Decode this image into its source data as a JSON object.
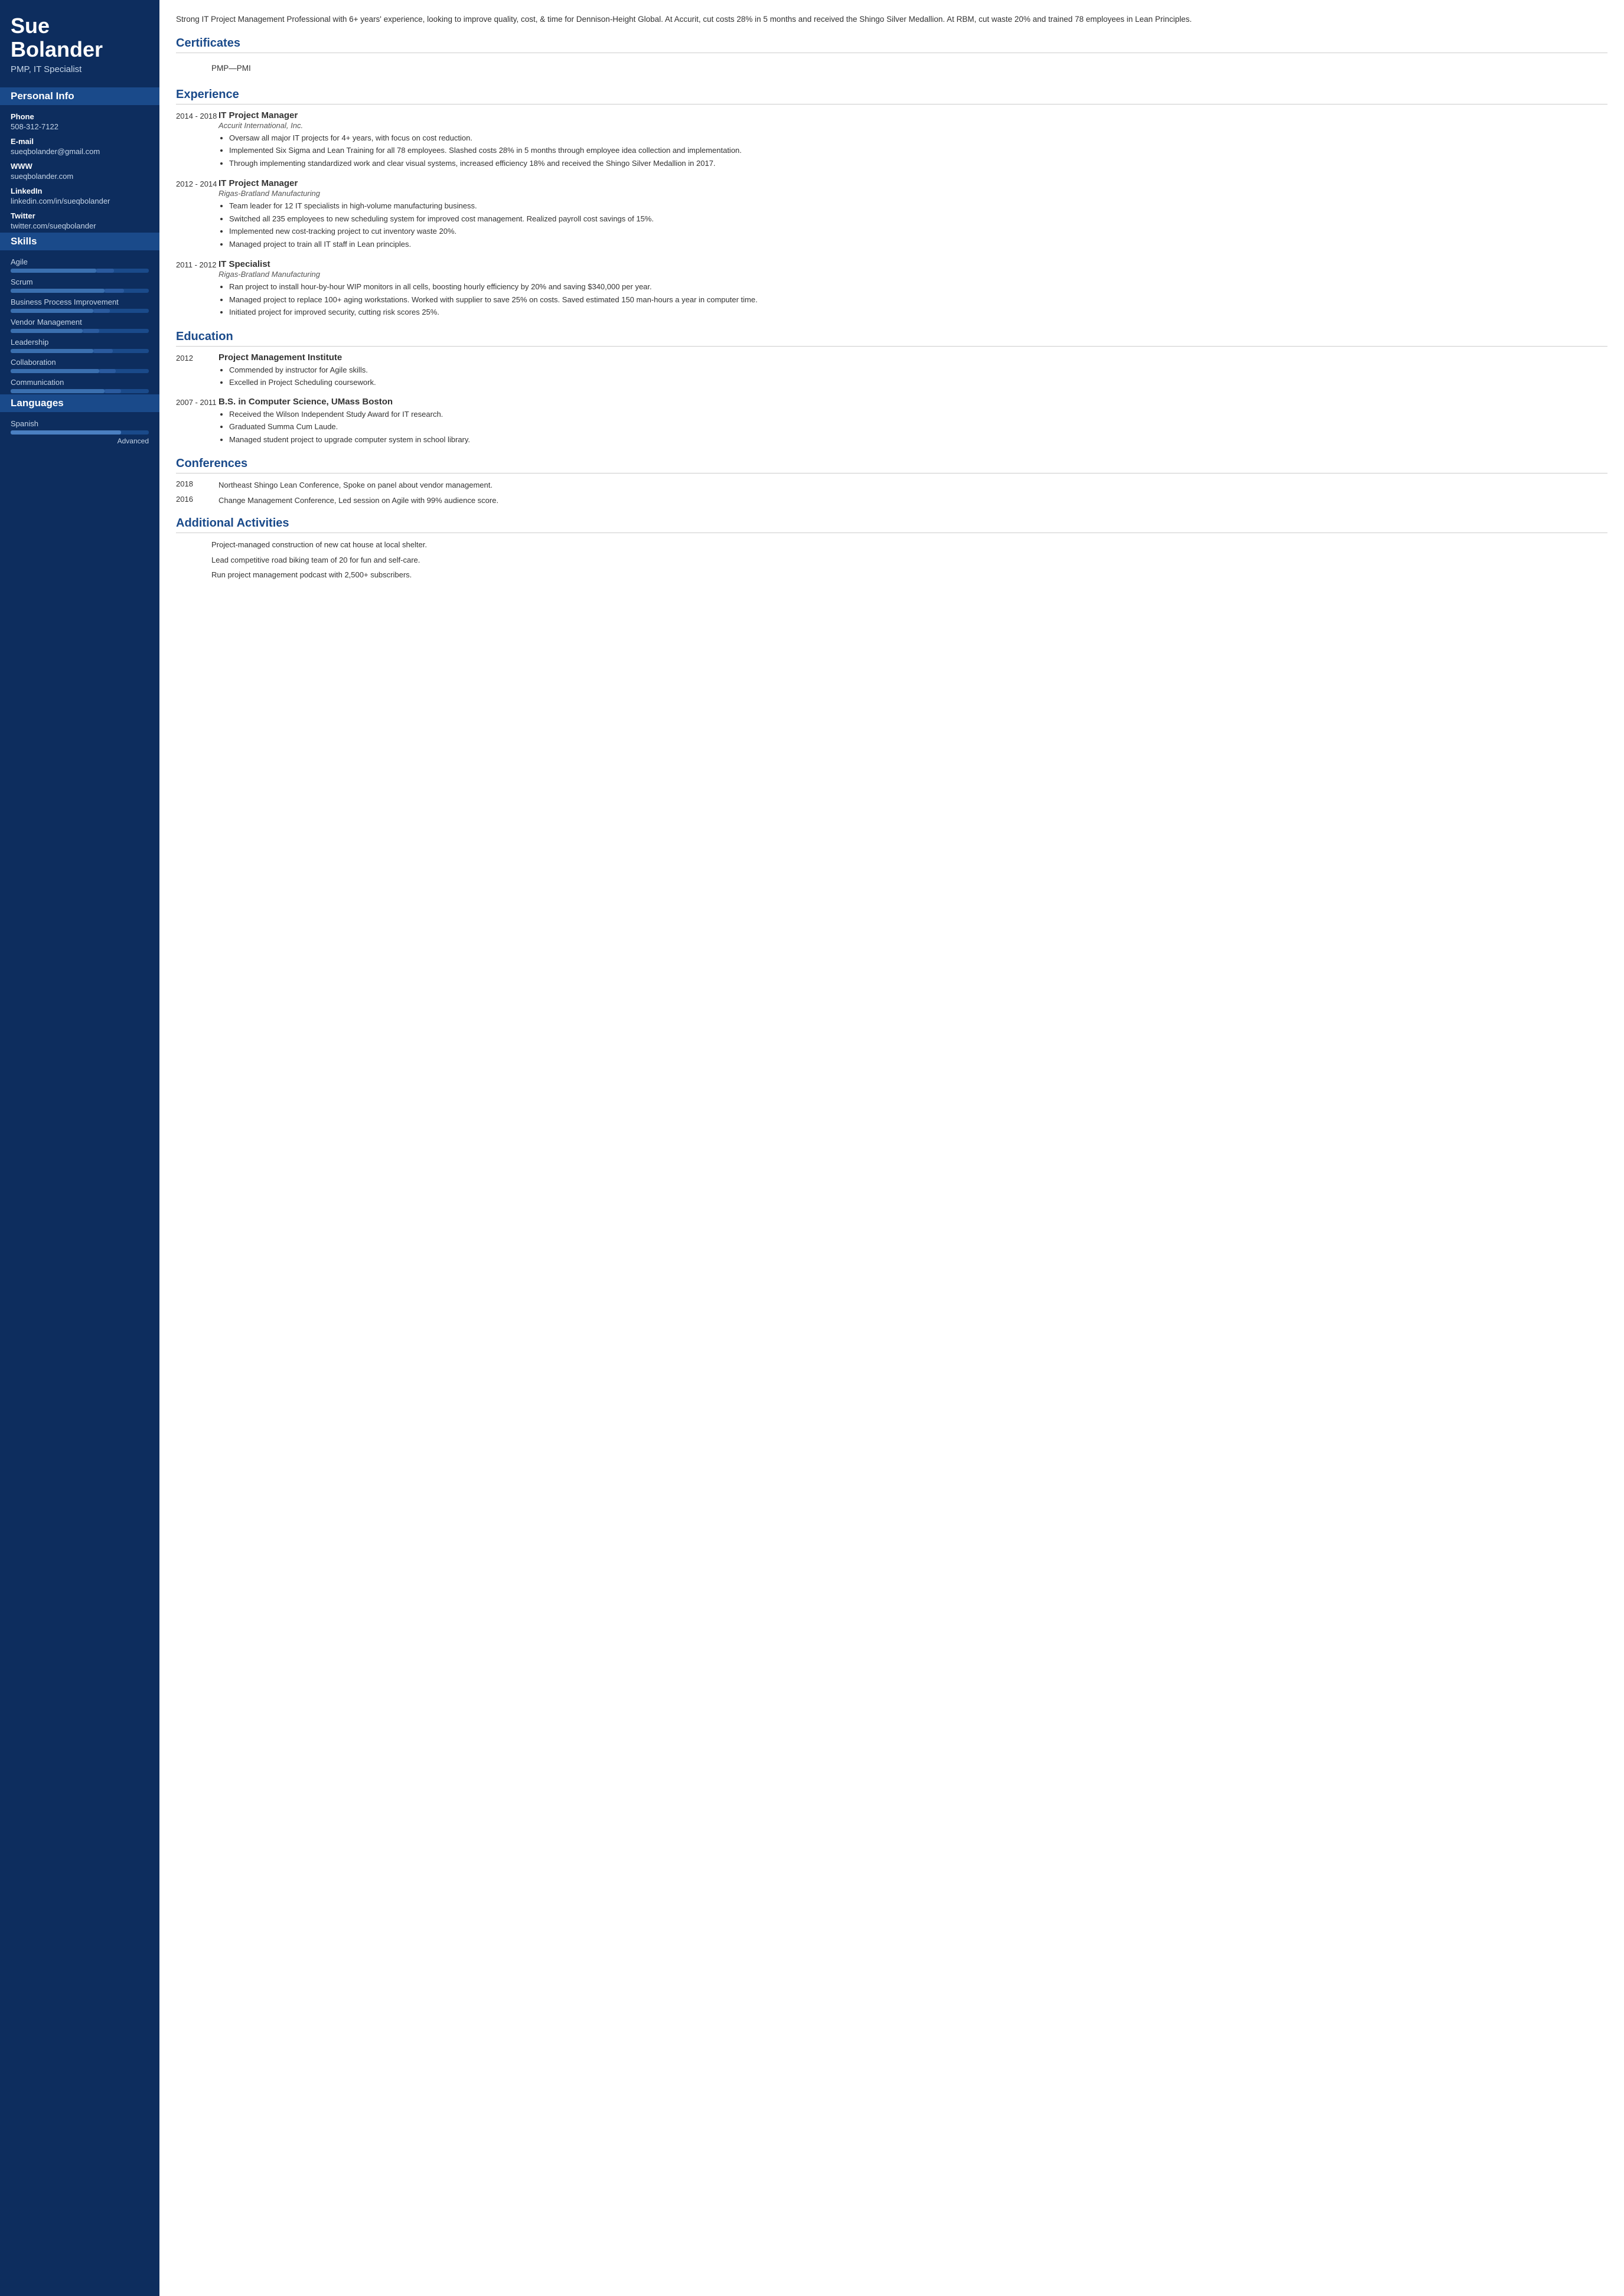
{
  "sidebar": {
    "name_line1": "Sue",
    "name_line2": "Bolander",
    "title": "PMP, IT Specialist",
    "personal_info_label": "Personal Info",
    "phone_label": "Phone",
    "phone_value": "508-312-7122",
    "email_label": "E-mail",
    "email_value": "sueqbolander@gmail.com",
    "www_label": "WWW",
    "www_value": "sueqbolander.com",
    "linkedin_label": "LinkedIn",
    "linkedin_value": "linkedin.com/in/sueqbolander",
    "twitter_label": "Twitter",
    "twitter_value": "twitter.com/sueqbolander",
    "skills_label": "Skills",
    "skills": [
      {
        "name": "Agile",
        "fill": 62,
        "accent": 75
      },
      {
        "name": "Scrum",
        "fill": 68,
        "accent": 82
      },
      {
        "name": "Business Process Improvement",
        "fill": 60,
        "accent": 72
      },
      {
        "name": "Vendor Management",
        "fill": 52,
        "accent": 64
      },
      {
        "name": "Leadership",
        "fill": 60,
        "accent": 74
      },
      {
        "name": "Collaboration",
        "fill": 64,
        "accent": 76
      },
      {
        "name": "Communication",
        "fill": 68,
        "accent": 80
      }
    ],
    "languages_label": "Languages",
    "languages": [
      {
        "name": "Spanish",
        "fill": 80,
        "level": "Advanced"
      }
    ]
  },
  "main": {
    "summary": "Strong IT Project Management Professional with 6+ years' experience, looking to improve quality, cost, & time for Dennison-Height Global. At Accurit, cut costs 28% in 5 months and received the Shingo Silver Medallion. At RBM, cut waste 20% and trained 78 employees in Lean Principles.",
    "certificates_label": "Certificates",
    "certificate_value": "PMP—PMI",
    "experience_label": "Experience",
    "experience": [
      {
        "date": "2014 - 2018",
        "title": "IT Project Manager",
        "company": "Accurit International, Inc.",
        "bullets": [
          "Oversaw all major IT projects for 4+ years, with focus on cost reduction.",
          "Implemented Six Sigma and Lean Training for all 78 employees. Slashed costs 28% in 5 months through employee idea collection and implementation.",
          "Through implementing standardized work and clear visual systems, increased efficiency 18% and received the Shingo Silver Medallion in 2017."
        ]
      },
      {
        "date": "2012 - 2014",
        "title": "IT Project Manager",
        "company": "Rigas-Bratland Manufacturing",
        "bullets": [
          "Team leader for 12 IT specialists in high-volume manufacturing business.",
          "Switched all 235 employees to new scheduling system for improved cost management. Realized payroll cost savings of 15%.",
          "Implemented new cost-tracking project to cut inventory waste 20%.",
          "Managed project to train all IT staff in Lean principles."
        ]
      },
      {
        "date": "2011 - 2012",
        "title": "IT Specialist",
        "company": "Rigas-Bratland Manufacturing",
        "bullets": [
          "Ran project to install hour-by-hour WIP monitors in all cells, boosting hourly efficiency by 20% and saving $340,000 per year.",
          "Managed project to replace 100+ aging workstations. Worked with supplier to save 25% on costs. Saved estimated 150 man-hours a year in computer time.",
          "Initiated project for improved security, cutting risk scores 25%."
        ]
      }
    ],
    "education_label": "Education",
    "education": [
      {
        "date": "2012",
        "school": "Project Management Institute",
        "bullets": [
          "Commended by instructor for Agile skills.",
          "Excelled in Project Scheduling coursework."
        ]
      },
      {
        "date": "2007 - 2011",
        "school": "B.S. in Computer Science, UMass Boston",
        "bullets": [
          "Received the Wilson Independent Study Award for IT research.",
          "Graduated Summa Cum Laude.",
          "Managed student project to upgrade computer system in school library."
        ]
      }
    ],
    "conferences_label": "Conferences",
    "conferences": [
      {
        "date": "2018",
        "desc": "Northeast Shingo Lean Conference, Spoke on panel about vendor management."
      },
      {
        "date": "2016",
        "desc": "Change Management Conference, Led session on Agile with 99% audience score."
      }
    ],
    "activities_label": "Additional Activities",
    "activities": [
      "Project-managed construction of new cat house at local shelter.",
      "Lead competitive road biking team of 20 for fun and self-care.",
      "Run project management podcast with 2,500+ subscribers."
    ]
  }
}
